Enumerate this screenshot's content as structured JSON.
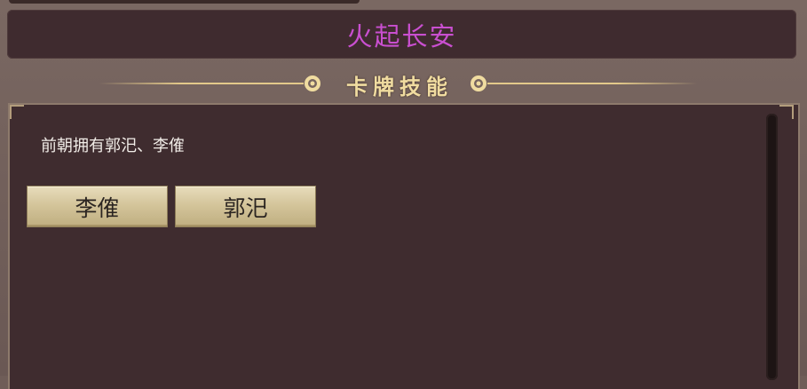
{
  "window": {
    "title": "火起长安"
  },
  "section": {
    "title": "卡牌技能"
  },
  "content": {
    "description": "前朝拥有郭汜、李傕",
    "choices": [
      {
        "label": "李傕"
      },
      {
        "label": "郭汜"
      }
    ]
  },
  "colors": {
    "title_text": "#c94fd0",
    "section_title": "#f0dca0",
    "panel_bg": "#3f2c2f",
    "button_bg": "#d4c59b"
  }
}
